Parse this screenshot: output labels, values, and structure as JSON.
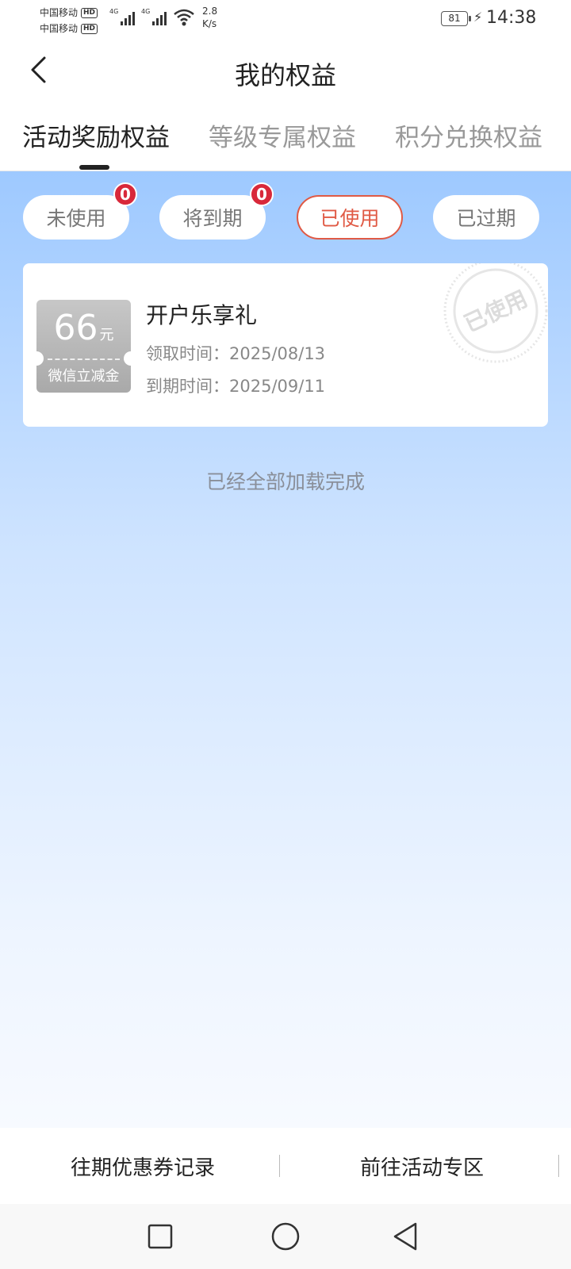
{
  "status": {
    "carrier1": "中国移动",
    "carrier2": "中国移动",
    "hd": "HD",
    "network": "4G",
    "speed_value": "2.8",
    "speed_unit": "K/s",
    "battery": "81",
    "time": "14:38"
  },
  "header": {
    "title": "我的权益",
    "back_icon": "chevron-left-icon"
  },
  "tabs": [
    {
      "label": "活动奖励权益",
      "active": true
    },
    {
      "label": "等级专属权益",
      "active": false
    },
    {
      "label": "积分兑换权益",
      "active": false
    }
  ],
  "filters": [
    {
      "label": "未使用",
      "badge": "0",
      "active": false
    },
    {
      "label": "将到期",
      "badge": "0",
      "active": false
    },
    {
      "label": "已使用",
      "active": true
    },
    {
      "label": "已过期",
      "active": false
    }
  ],
  "coupons": [
    {
      "amount": "66",
      "unit": "元",
      "coupon_name": "微信立减金",
      "title": "开户乐享礼",
      "received": "领取时间：2025/08/13",
      "expires": "到期时间：2025/09/11",
      "stamp": "已使用"
    }
  ],
  "list_end_text": "已经全部加载完成",
  "bottom": {
    "history_link": "往期优惠券记录",
    "activity_link": "前往活动专区"
  },
  "colors": {
    "accent": "#e05a45",
    "badge": "#d8283a",
    "gradient_top": "#9ec9ff"
  }
}
